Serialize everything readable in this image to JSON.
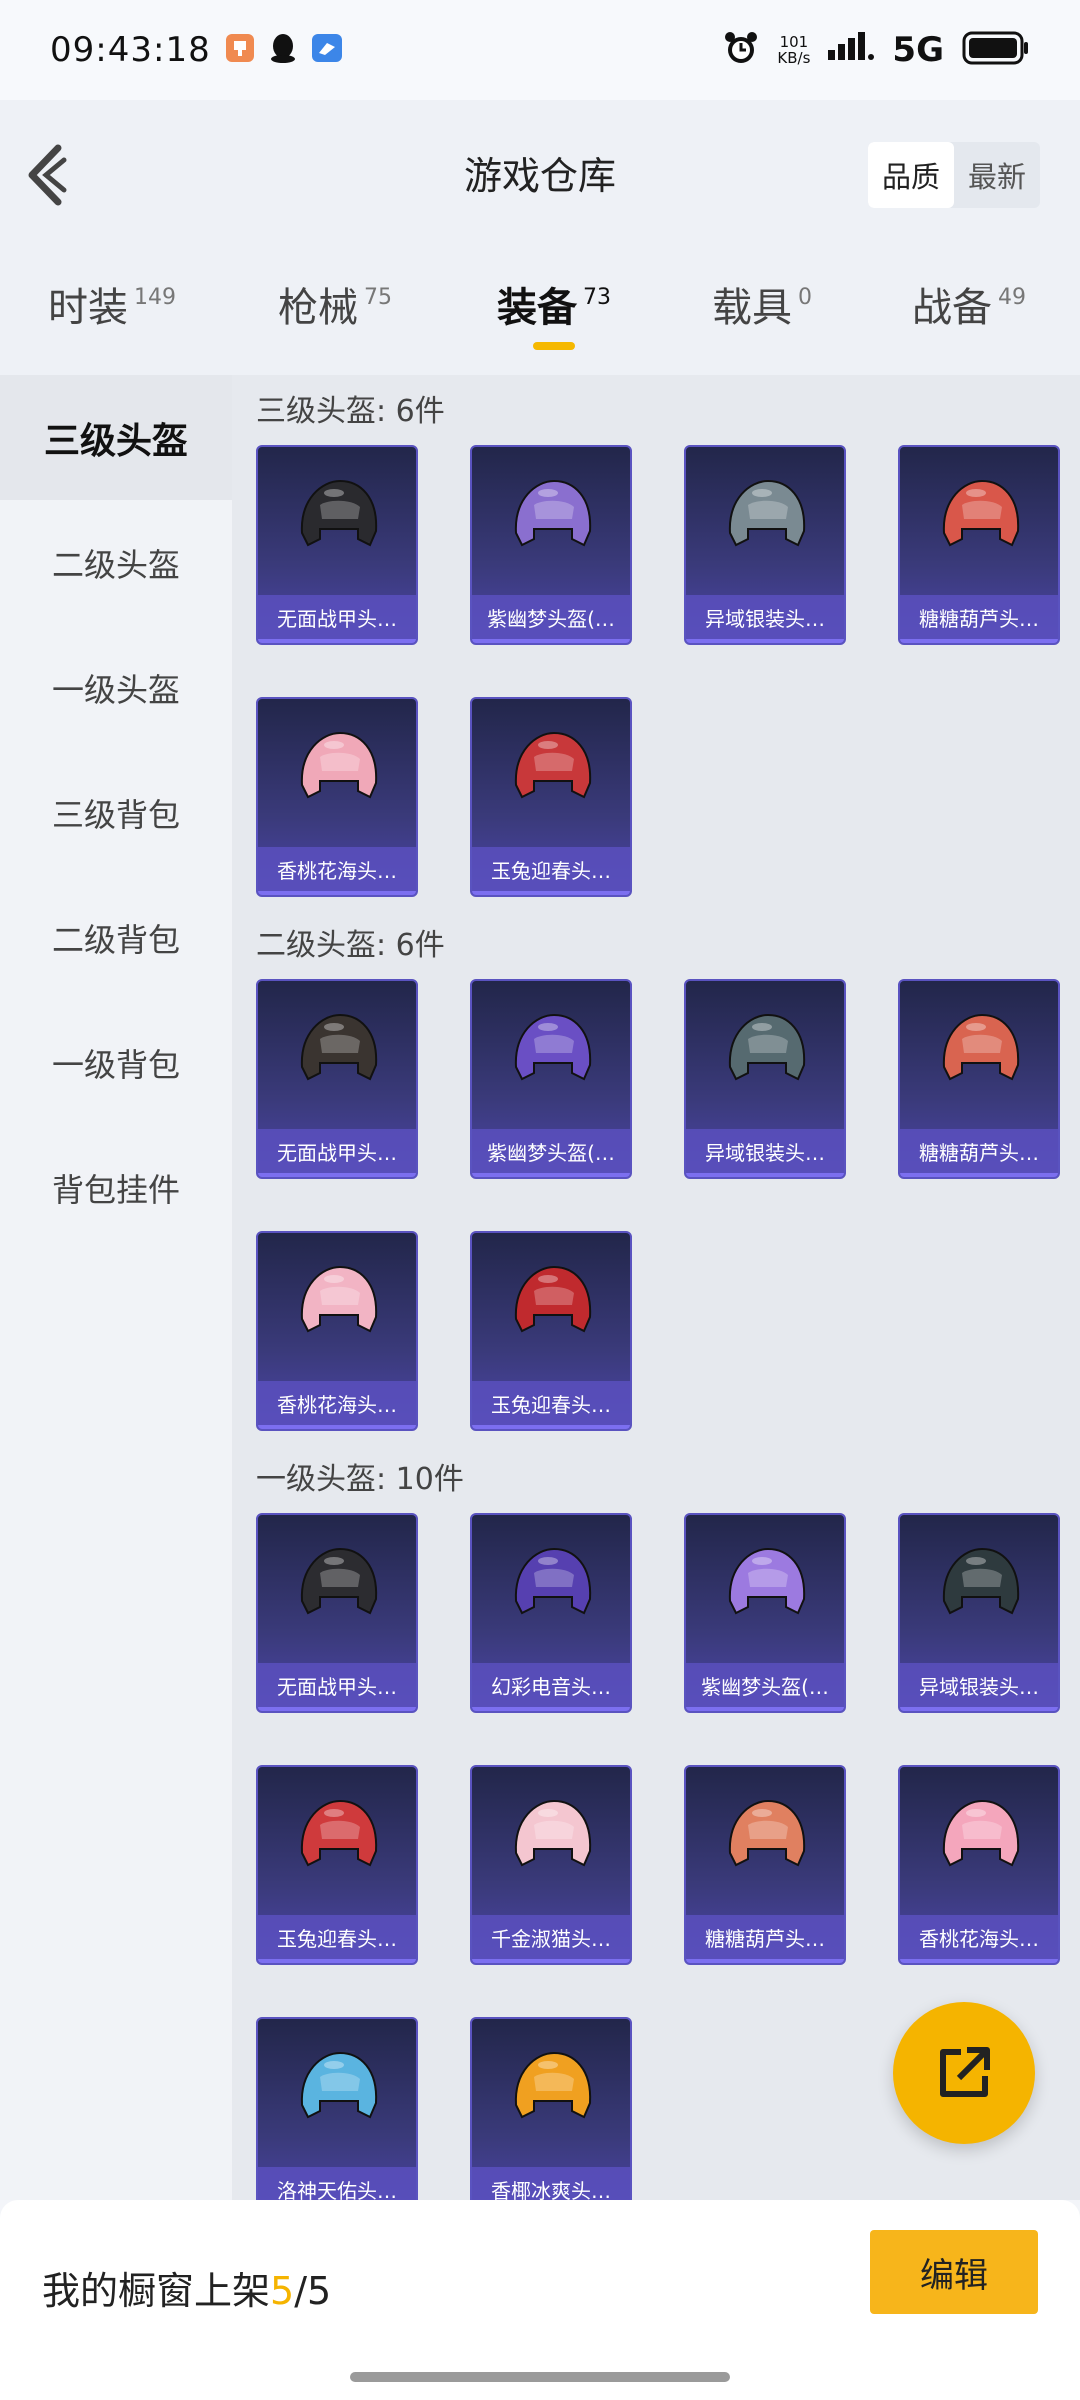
{
  "status_bar": {
    "time": "09:43:18",
    "net_speed": "101",
    "net_unit": "KB/s",
    "network": "5G"
  },
  "header": {
    "title": "游戏仓库",
    "sort_options": [
      "品质",
      "最新"
    ],
    "sort_active": "品质"
  },
  "tabs": [
    {
      "label": "时装",
      "count": "149"
    },
    {
      "label": "枪械",
      "count": "75"
    },
    {
      "label": "装备",
      "count": "73",
      "active": true
    },
    {
      "label": "载具",
      "count": "0"
    },
    {
      "label": "战备",
      "count": "49"
    }
  ],
  "sidebar": {
    "items": [
      "三级头盔",
      "二级头盔",
      "一级头盔",
      "三级背包",
      "二级背包",
      "一级背包",
      "背包挂件"
    ],
    "active": "三级头盔"
  },
  "sections": [
    {
      "title": "三级头盔: 6件",
      "items": [
        {
          "name": "无面战甲头…",
          "color": "#2a2a2e"
        },
        {
          "name": "紫幽梦头盔(…",
          "color": "#8a6fcf"
        },
        {
          "name": "异域银装头…",
          "color": "#7a8a92"
        },
        {
          "name": "糖糖葫芦头…",
          "color": "#d9574a"
        },
        {
          "name": "香桃花海头…",
          "color": "#f0a8b8"
        },
        {
          "name": "玉兔迎春头…",
          "color": "#c8383a"
        }
      ]
    },
    {
      "title": "二级头盔: 6件",
      "items": [
        {
          "name": "无面战甲头…",
          "color": "#3a3430"
        },
        {
          "name": "紫幽梦头盔(…",
          "color": "#6a4fc4"
        },
        {
          "name": "异域银装头…",
          "color": "#566a70"
        },
        {
          "name": "糖糖葫芦头…",
          "color": "#d96450"
        },
        {
          "name": "香桃花海头…",
          "color": "#f2b4c4"
        },
        {
          "name": "玉兔迎春头…",
          "color": "#c02a2e"
        }
      ]
    },
    {
      "title": "一级头盔: 10件",
      "items": [
        {
          "name": "无面战甲头…",
          "color": "#2c2c30"
        },
        {
          "name": "幻彩电音头…",
          "color": "#5640b0"
        },
        {
          "name": "紫幽梦头盔(…",
          "color": "#9c7ae0"
        },
        {
          "name": "异域银装头…",
          "color": "#2e3a3e"
        },
        {
          "name": "玉兔迎春头…",
          "color": "#cf3a3c"
        },
        {
          "name": "千金淑猫头…",
          "color": "#f4c6d0"
        },
        {
          "name": "糖糖葫芦头…",
          "color": "#e08060"
        },
        {
          "name": "香桃花海头…",
          "color": "#f4a6bc"
        },
        {
          "name": "洛神天佑头…",
          "color": "#5ab4e0"
        },
        {
          "name": "香椰冰爽头…",
          "color": "#f0a020"
        }
      ]
    }
  ],
  "bottom_bar": {
    "showcase_prefix": "我的橱窗上架",
    "showcase_current": "5",
    "showcase_suffix": "/5",
    "edit_label": "编辑"
  }
}
